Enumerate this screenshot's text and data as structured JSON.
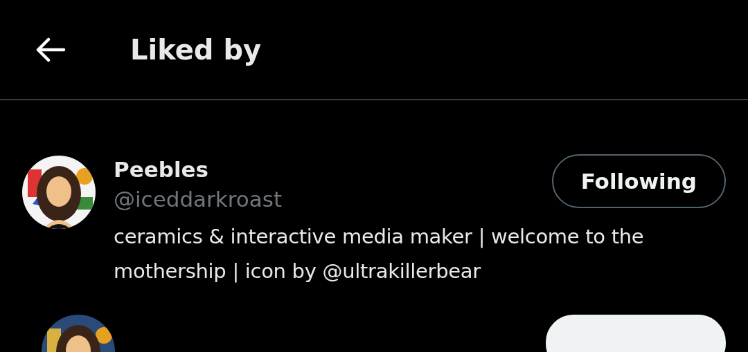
{
  "header": {
    "title": "Liked by"
  },
  "users": [
    {
      "kind": "user",
      "name": "Peebles",
      "handle": "@iceddarkroast",
      "bio": "ceramics & interactive media maker | welcome to the mothership | icon by @ultrakillerbear",
      "following": true,
      "button": "Following"
    },
    {
      "kind": "user_cut",
      "following": false
    }
  ]
}
